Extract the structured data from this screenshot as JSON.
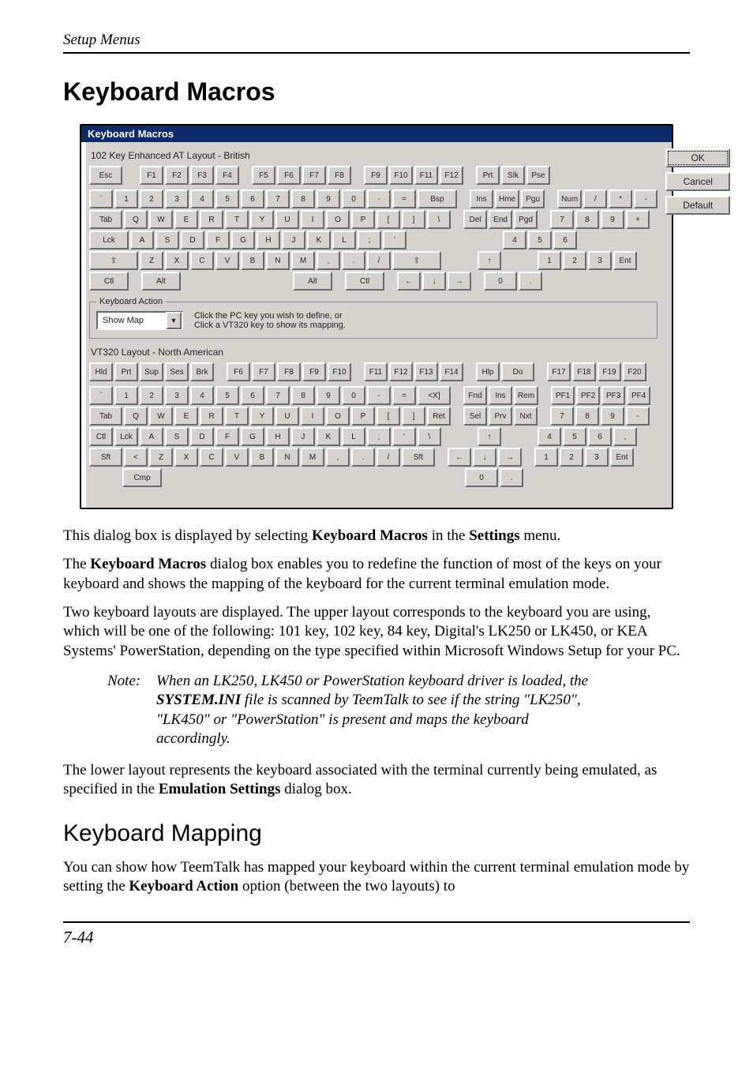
{
  "running_head": "Setup Menus",
  "page_number": "7-44",
  "h1": "Keyboard Macros",
  "dialog": {
    "title": "Keyboard Macros",
    "layout_upper_title": "102 Key Enhanced AT Layout - British",
    "action_legend": "Keyboard Action",
    "action_dropdown": "Show Map",
    "action_hint_line1": "Click the PC key you wish to define, or",
    "action_hint_line2": "Click a VT320 key to show its mapping.",
    "layout_lower_title": "VT320 Layout - North American",
    "buttons": {
      "ok": "OK",
      "cancel": "Cancel",
      "default": "Default"
    },
    "upper_rows": {
      "r1": [
        "Esc",
        "F1",
        "F2",
        "F3",
        "F4",
        "F5",
        "F6",
        "F7",
        "F8",
        "F9",
        "F10",
        "F11",
        "F12",
        "Prt",
        "Slk",
        "Pse"
      ],
      "r2": [
        "`",
        "1",
        "2",
        "3",
        "4",
        "5",
        "6",
        "7",
        "8",
        "9",
        "0",
        "-",
        "=",
        "Bsp",
        "Ins",
        "Hme",
        "Pgu",
        "Num",
        "/",
        "*",
        "-"
      ],
      "r3": [
        "Tab",
        "Q",
        "W",
        "E",
        "R",
        "T",
        "Y",
        "U",
        "I",
        "O",
        "P",
        "[",
        "]",
        "\\",
        "Del",
        "End",
        "Pgd",
        "7",
        "8",
        "9",
        "+"
      ],
      "r4": [
        "Lck",
        "A",
        "S",
        "D",
        "F",
        "G",
        "H",
        "J",
        "K",
        "L",
        ";",
        "'",
        "4",
        "5",
        "6"
      ],
      "r5": [
        "⇧",
        "Z",
        "X",
        "C",
        "V",
        "B",
        "N",
        "M",
        ",",
        ".",
        "/",
        "⇧",
        "↑",
        "1",
        "2",
        "3",
        "Ent"
      ],
      "r6": [
        "Ctl",
        "Alt",
        "Alt",
        "Ctl",
        "←",
        "↓",
        "→",
        "0",
        "."
      ]
    },
    "lower_rows": {
      "r1": [
        "Hld",
        "Prt",
        "Sup",
        "Ses",
        "Brk",
        "F6",
        "F7",
        "F8",
        "F9",
        "F10",
        "F11",
        "F12",
        "F13",
        "F14",
        "Hlp",
        "Do",
        "F17",
        "F18",
        "F19",
        "F20"
      ],
      "r2": [
        "`",
        "1",
        "2",
        "3",
        "4",
        "5",
        "6",
        "7",
        "8",
        "9",
        "0",
        "-",
        "=",
        "<X]",
        "Fnd",
        "Ins",
        "Rem",
        "PF1",
        "PF2",
        "PF3",
        "PF4"
      ],
      "r3": [
        "Tab",
        "Q",
        "W",
        "E",
        "R",
        "T",
        "Y",
        "U",
        "I",
        "O",
        "P",
        "[",
        "]",
        "Ret",
        "Sel",
        "Prv",
        "Nxt",
        "7",
        "8",
        "9",
        "-"
      ],
      "r4": [
        "Ctl",
        "Lck",
        "A",
        "S",
        "D",
        "F",
        "G",
        "H",
        "J",
        "K",
        "L",
        ";",
        "'",
        "\\",
        "↑",
        "4",
        "5",
        "6",
        ","
      ],
      "r5": [
        "Sft",
        "<",
        "Z",
        "X",
        "C",
        "V",
        "B",
        "N",
        "M",
        ",",
        ".",
        "/",
        "Sft",
        "←",
        "↓",
        "→",
        "1",
        "2",
        "3",
        "Ent"
      ],
      "r6": [
        "Cmp",
        "0",
        "."
      ]
    }
  },
  "para1_pre": "This dialog box is displayed by selecting ",
  "para1_b1": "Keyboard Macros",
  "para1_mid": " in the ",
  "para1_b2": "Settings",
  "para1_post": " menu.",
  "para2_pre": "The ",
  "para2_b": "Keyboard Macros",
  "para2_post": " dialog box enables you to redefine the function of most of the keys on your keyboard and shows the mapping of the keyboard for the current terminal emulation mode.",
  "para3": "Two keyboard layouts are displayed. The upper layout corresponds to the keyboard you are using, which will be one of the following: 101 key, 102 key, 84 key, Digital's LK250 or LK450, or KEA Systems' PowerStation, depending on the type specified within Microsoft Windows Setup for your PC.",
  "note_label": "Note:",
  "note_pre": "When an LK250, LK450 or PowerStation keyboard driver is loaded, the ",
  "note_b": "SYSTEM.INI",
  "note_post": " file is scanned by TeemTalk to see if the string \"LK250\", \"LK450\" or \"PowerStation\" is present and maps the keyboard accordingly.",
  "para4_pre": "The lower layout represents the keyboard associated with the terminal currently being emulated, as specified in the ",
  "para4_b": "Emulation Settings",
  "para4_post": " dialog box.",
  "h2": "Keyboard Mapping",
  "para5_pre": "You can show how TeemTalk has mapped your keyboard within the current terminal emulation mode by setting the ",
  "para5_b": "Keyboard Action",
  "para5_post": " option (between the two layouts) to"
}
